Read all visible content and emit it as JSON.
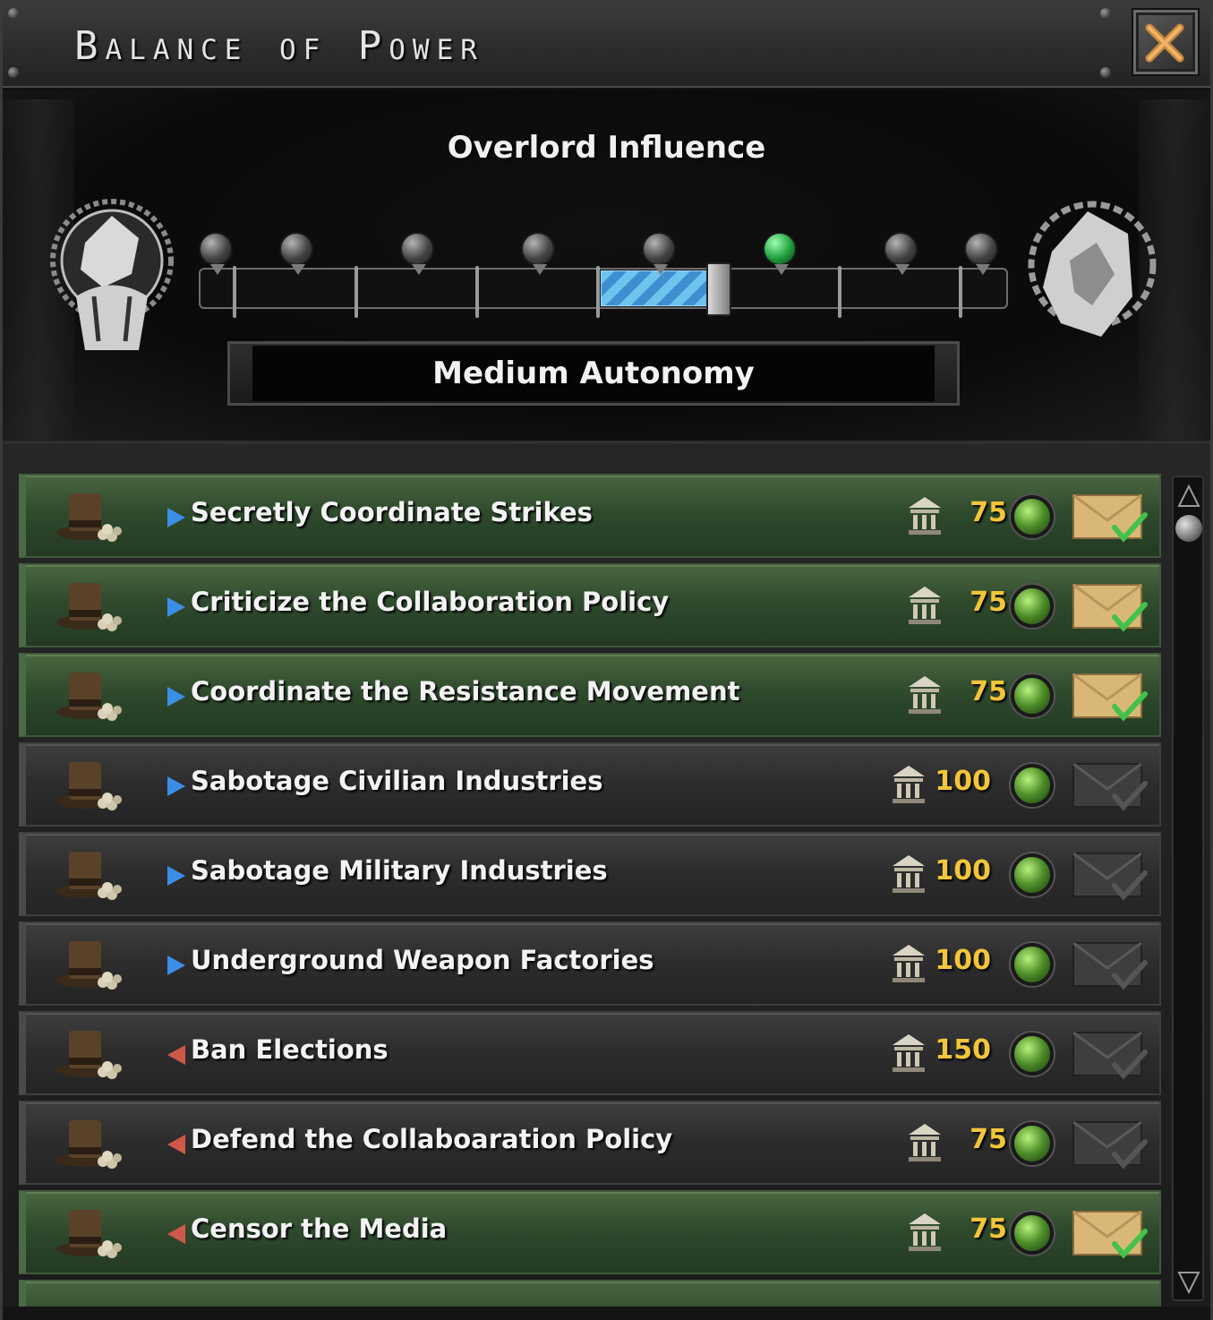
{
  "window": {
    "title": "Balance of Power"
  },
  "influence": {
    "heading": "Overlord Influence",
    "status": "Medium Autonomy",
    "marker_count": 8,
    "active_marker": 6,
    "progress": 0.63
  },
  "decisions": [
    {
      "label": "Secretly Coordinate Strikes",
      "direction": "right",
      "cost": "75",
      "available": true
    },
    {
      "label": "Criticize the Collaboration Policy",
      "direction": "right",
      "cost": "75",
      "available": true
    },
    {
      "label": "Coordinate the Resistance Movement",
      "direction": "right",
      "cost": "75",
      "available": true
    },
    {
      "label": "Sabotage Civilian Industries",
      "direction": "right",
      "cost": "100",
      "available": false
    },
    {
      "label": "Sabotage Military Industries",
      "direction": "right",
      "cost": "100",
      "available": false
    },
    {
      "label": "Underground Weapon Factories",
      "direction": "right",
      "cost": "100",
      "available": false
    },
    {
      "label": "Ban Elections",
      "direction": "left",
      "cost": "150",
      "available": false
    },
    {
      "label": "Defend the Collaboaration Policy",
      "direction": "left",
      "cost": "75",
      "available": false
    },
    {
      "label": "Censor the Media",
      "direction": "left",
      "cost": "75",
      "available": true
    }
  ],
  "colors": {
    "accent_blue": "#3b8ee6",
    "accent_red": "#d0584a",
    "cost_gold": "#f2c53a",
    "available_green": "#2f4a2d"
  }
}
